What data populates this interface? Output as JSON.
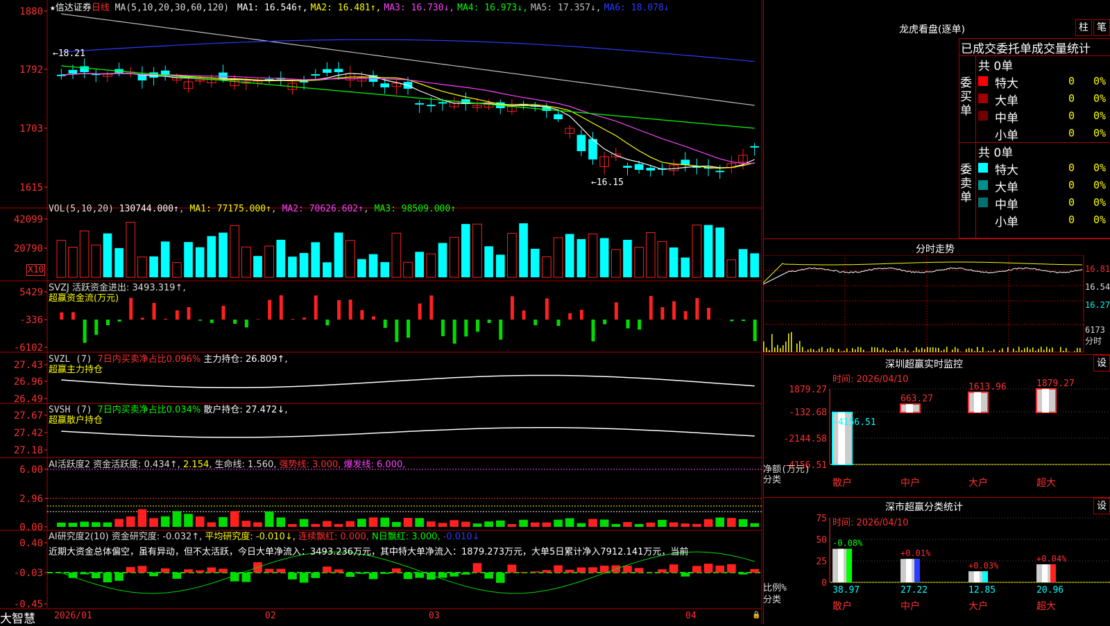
{
  "stock": {
    "name": "★信达证券",
    "period": "日线",
    "ma_label": "MA(5,10,20,30,60,120)",
    "ma": [
      {
        "label": "MA1: 16.546↑",
        "color": "#ffffff"
      },
      {
        "label": "MA2: 16.481↑",
        "color": "#ffff00"
      },
      {
        "label": "MA3: 16.730↓",
        "color": "#ff44ff"
      },
      {
        "label": "MA4: 16.973↓",
        "color": "#00ff00"
      },
      {
        "label": "MA5: 17.357↓",
        "color": "#c0c0c0"
      },
      {
        "label": "MA6: 18.078↓",
        "color": "#2a3cff"
      }
    ],
    "price_axis": [
      "1880",
      "1792",
      "1703",
      "1615"
    ],
    "high_note": "←18.21",
    "low_note": "←16.15"
  },
  "vol": {
    "label": "VOL(5,10,20)",
    "value": "130744.000↑",
    "ma1": "MA1: 77175.000↑",
    "ma2": "MA2: 70626.602↑",
    "ma3": "MA3: 98509.000↑",
    "axis": [
      "42099",
      "20790"
    ],
    "unit": "X10"
  },
  "svzj": {
    "label": "SVZJ  活跃资金进出: 3493.319↑,",
    "sub": "超赢资金流(万元)",
    "axis": [
      "5429",
      "-336",
      "-6102"
    ]
  },
  "svzl": {
    "label": "SVZL (7) ",
    "l2": "7日内买卖净占比0.096%",
    "l3": " 主力持仓: 26.809↑,",
    "sub": "超赢主力持仓",
    "axis": [
      "27.43",
      "26.96",
      "26.49"
    ]
  },
  "svsh": {
    "label": "SVSH (7) ",
    "l2": "7日内买卖净占比0.034%",
    "l3": " 散户持仓: 27.472↓,",
    "sub": "超赢散户持仓",
    "axis": [
      "27.67",
      "27.42",
      "27.18"
    ]
  },
  "ai1": {
    "label": "AI活跃度2 资金活跃度: 0.434↑, ",
    "l2": "2.154",
    "l3": ", 生命线: 1.560, ",
    "l4": "强势线: 3.000, ",
    "l5": "爆发线: 6.000,",
    "axis": [
      "6.00",
      "2.96",
      "0.00"
    ]
  },
  "ai2": {
    "label": "AI研究度2(10) 资金研究度: -0.032↑, ",
    "l2": "平均研究度: -0.010↓, ",
    "l3": "连续飘红: 0.000, ",
    "l4": "N日飘红: 3.000, ",
    "l5": "-0.010↓",
    "note": "近期大资金总体偏空，虽有异动，但不太活跃，今日大单净流入：3493.236万元，其中特大单净流入：1879.273万元，大单5日累计净入7912.141万元，当前",
    "axis": [
      "0.40",
      "-0.03",
      "-0.45"
    ]
  },
  "xaxis": {
    "brand": "大智慧",
    "labels": [
      "2026/01",
      "02",
      "03",
      "04"
    ]
  },
  "longhu": {
    "title": "龙虎看盘(逐单)",
    "btn1": "柱",
    "btn2": "笔",
    "tabs": "已成交委托单成交量统计",
    "buy": {
      "side": "委买单",
      "total": "共 0单",
      "rows": [
        {
          "name": "特大",
          "qty": "0",
          "pct": "0%",
          "color": "#ff0000"
        },
        {
          "name": "大单",
          "qty": "0",
          "pct": "0%",
          "color": "#a00000"
        },
        {
          "name": "中单",
          "qty": "0",
          "pct": "0%",
          "color": "#700000"
        },
        {
          "name": "小单",
          "qty": "0",
          "pct": "0%",
          "color": "#000000"
        }
      ]
    },
    "sell": {
      "side": "委卖单",
      "total": "共 0单",
      "rows": [
        {
          "name": "特大",
          "qty": "0",
          "pct": "0%",
          "color": "#00ffff"
        },
        {
          "name": "大单",
          "qty": "0",
          "pct": "0%",
          "color": "#009090"
        },
        {
          "name": "中单",
          "qty": "0",
          "pct": "0%",
          "color": "#007070"
        },
        {
          "name": "小单",
          "qty": "0",
          "pct": "0%",
          "color": "#000000"
        }
      ]
    }
  },
  "fenshi": {
    "title": "分时走势",
    "axis": [
      "16.81",
      "16.54",
      "16.27",
      "6173",
      "分时"
    ]
  },
  "monitor": {
    "title": "深圳超赢实时监控",
    "btn": "设",
    "time": "时间: 2026/04/10",
    "axis": [
      "1879.27",
      "-132.68",
      "-2144.58",
      "-4156.51"
    ],
    "ylabel": "净额(万元)",
    "xlabel": "分类",
    "bars": [
      {
        "cat": "散户",
        "value": -4156.51,
        "label": "-4156.51"
      },
      {
        "cat": "中户",
        "value": 663.27,
        "label": "663.27"
      },
      {
        "cat": "大户",
        "value": 1613.96,
        "label": "1613.96"
      },
      {
        "cat": "超大",
        "value": 1879.27,
        "label": "1879.27"
      }
    ]
  },
  "classify": {
    "title": "深市超赢分类统计",
    "btn": "设",
    "time": "时间: 2026/04/10",
    "axis": [
      "75",
      "50",
      "25",
      "0"
    ],
    "ylabel": "比例%",
    "xlabel": "分类",
    "bars": [
      {
        "cat": "散户",
        "value": 38.97,
        "label": "38.97",
        "chg": "-0.08%"
      },
      {
        "cat": "中户",
        "value": 27.22,
        "label": "27.22",
        "chg": "+0.01%"
      },
      {
        "cat": "大户",
        "value": 12.85,
        "label": "12.85",
        "chg": "+0.03%"
      },
      {
        "cat": "超大",
        "value": 20.96,
        "label": "20.96",
        "chg": "+0.04%"
      }
    ]
  }
}
